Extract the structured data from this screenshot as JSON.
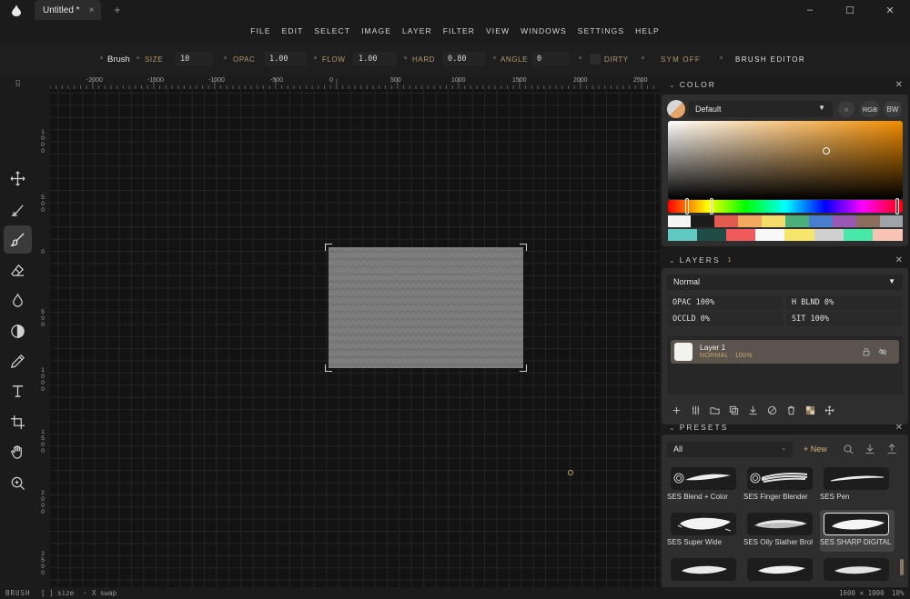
{
  "window": {
    "tab_title": "Untitled *",
    "tab_close": "×",
    "add_tab": "+",
    "controls": [
      "–",
      "☐",
      "✕"
    ]
  },
  "menu": [
    "FILE",
    "EDIT",
    "SELECT",
    "IMAGE",
    "LAYER",
    "FILTER",
    "VIEW",
    "WINDOWS",
    "SETTINGS",
    "HELP"
  ],
  "toolbar": {
    "title": "Brush",
    "size_label": "SIZE",
    "size_value": "10",
    "opac_label": "OPAC",
    "opac_value": "1.00",
    "flow_label": "FLOW",
    "flow_value": "1.00",
    "hard_label": "HARD",
    "hard_value": "0.80",
    "angle_label": "ANGLE",
    "angle_value": "0",
    "dirty_label": "DIRTY",
    "sym_label": "SYM OFF",
    "editor_label": "BRUSH EDITOR"
  },
  "tools": [
    {
      "name": "move-tool",
      "icon": "move-icon"
    },
    {
      "name": "smudge-tool",
      "icon": "smudge-icon"
    },
    {
      "name": "brush-tool",
      "icon": "brush-icon",
      "active": true
    },
    {
      "name": "eraser-tool",
      "icon": "eraser-icon"
    },
    {
      "name": "blur-tool",
      "icon": "droplet-icon"
    },
    {
      "name": "dodge-tool",
      "icon": "dodge-icon"
    },
    {
      "name": "eyedropper-tool",
      "icon": "eyedropper-icon"
    },
    {
      "name": "text-tool",
      "icon": "text-icon"
    },
    {
      "name": "crop-tool",
      "icon": "crop-icon"
    },
    {
      "name": "hand-tool",
      "icon": "hand-icon"
    },
    {
      "name": "zoom-tool",
      "icon": "zoom-icon"
    }
  ],
  "rulers": {
    "top": [
      "-2000",
      "-1500",
      "-1000",
      "-500",
      "0",
      "500",
      "1000",
      "1500",
      "2000",
      "2500"
    ],
    "left": [
      "1\n0\n0\n0",
      "5\n0\n0",
      "0",
      "5\n0\n0",
      "1\n0\n0\n0",
      "1\n5\n0\n0",
      "2\n0\n0\n0",
      "2\n5\n0\n0"
    ]
  },
  "color": {
    "title": "COLOR",
    "palette": "Default",
    "caret": "▼",
    "mode_circle": "○",
    "mode_rgb": "RGB",
    "mode_bw": "BW",
    "hue_color": "#f08c00",
    "row1": [
      "#f4f4f4",
      "#1c1c1c",
      "#e25b4f",
      "#f1a95f",
      "#f3dc6a",
      "#4caf7a",
      "#4a7fd0",
      "#9b59b6",
      "#8c6e5c",
      "#a0a4a8"
    ],
    "row2": [
      "#5fc8c0",
      "#1f4d45",
      "#f05a5a",
      "#f8f8f8",
      "#f5e56b",
      "#d0d0d0",
      "#48e8a8",
      "#f9c3b3"
    ]
  },
  "layers": {
    "title": "LAYERS",
    "count": "1",
    "blend": "Normal",
    "caret": "▼",
    "opac": "OPAC 100%",
    "h_blnd": "H BLND 0%",
    "occld": "OCCLD 0%",
    "sit": "SIT 100%",
    "items": [
      {
        "name": "Layer 1",
        "sub": "NORMAL · 100%"
      }
    ]
  },
  "presets": {
    "title": "PRESETS",
    "filter": "All",
    "new_label": "+ New",
    "items": [
      {
        "label": "SES Blend + Color"
      },
      {
        "label": "SES Finger Blender"
      },
      {
        "label": "SES Pen"
      },
      {
        "label": "SES Super Wide"
      },
      {
        "label": "SES Oily Slather Brol"
      },
      {
        "label": "SES SHARP DIGITAL",
        "selected": true
      }
    ]
  },
  "status": {
    "mode": "BRUSH",
    "hint_size": "[ ] size",
    "sep": "·",
    "hint_swap": "X swap",
    "dimensions": "1600 × 1000",
    "zoom": "18%"
  },
  "accent": "#b39a6e",
  "close_glyph": "✕",
  "chevron_glyph": "⌄"
}
